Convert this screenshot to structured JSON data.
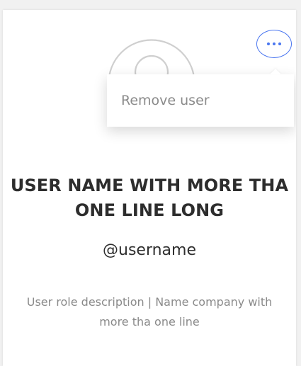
{
  "user": {
    "name": "USER NAME WITH MORE THA ONE LINE LONG",
    "username": "@username",
    "role": "User role description | Name company with more tha one line"
  },
  "menu": {
    "more_icon": "more-horizontal-icon",
    "items": [
      {
        "label": "Remove user"
      }
    ]
  },
  "colors": {
    "accent": "#4a76f0",
    "text_primary": "#2d2d2d",
    "text_secondary": "#8a8a8a",
    "dropdown_text": "#8b8b8b",
    "avatar_line": "#cfcfcf"
  }
}
